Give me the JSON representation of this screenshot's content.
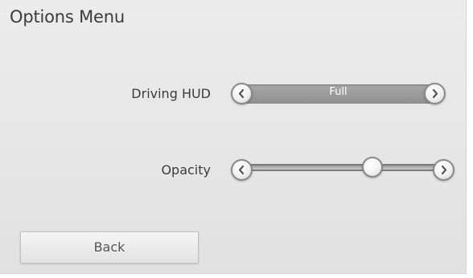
{
  "menu": {
    "title": "Options Menu"
  },
  "settings": [
    {
      "label": "Driving HUD",
      "type": "cycle",
      "value": "Full",
      "prev_icon": "chevron-left-icon",
      "next_icon": "chevron-right-icon"
    },
    {
      "label": "Opacity",
      "type": "slider",
      "level_fraction": 0.64,
      "prev_icon": "chevron-left-icon",
      "next_icon": "chevron-right-icon"
    }
  ],
  "actions": {
    "back_label": "Back"
  },
  "colors": {
    "panel": "#e8e8e8",
    "cycle_bar": "#9b9b9b",
    "text": "#3c3c3c"
  }
}
